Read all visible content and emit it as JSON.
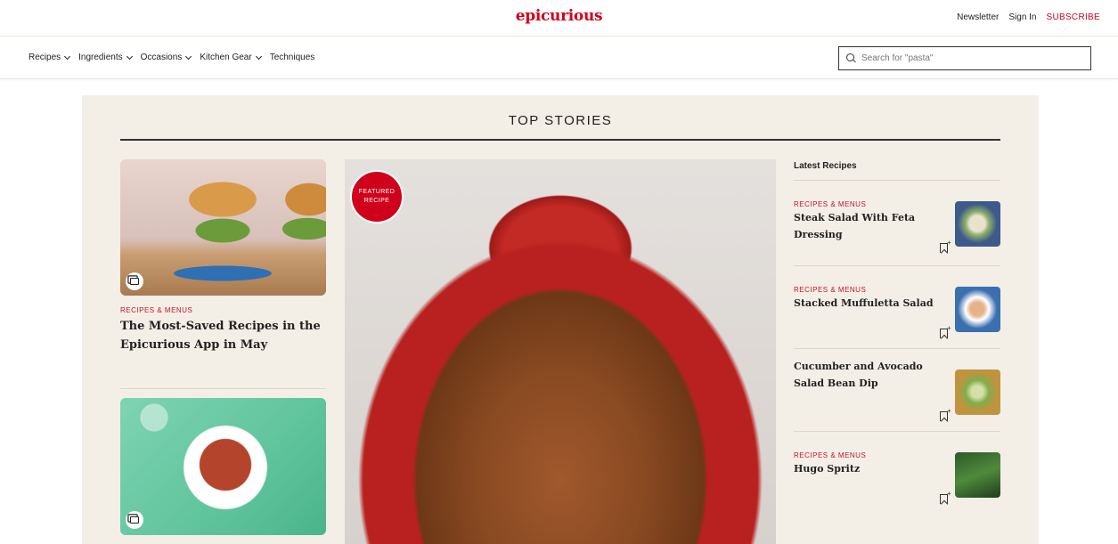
{
  "header": {
    "logo": "epicurious",
    "links": {
      "newsletter": "Newsletter",
      "sign_in": "Sign In",
      "subscribe": "SUBSCRIBE"
    }
  },
  "nav": {
    "items": [
      "Recipes",
      "Ingredients",
      "Occasions",
      "Kitchen Gear",
      "Techniques"
    ],
    "search_placeholder": "Search for \"pasta\""
  },
  "top_stories": {
    "title": "TOP STORIES",
    "left_cards": [
      {
        "kicker": "RECIPES & MENUS",
        "title": "The Most-Saved Recipes in the Epicurious App in May",
        "image": "burgers"
      },
      {
        "kicker": "",
        "title": "",
        "image": "bowl"
      }
    ],
    "featured": {
      "badge_line1": "FEATURED",
      "badge_line2": "RECIPE",
      "image": "bread-in-red-pot"
    },
    "latest": {
      "heading": "Latest Recipes",
      "items": [
        {
          "kicker": "RECIPES & MENUS",
          "title": "Steak Salad With Feta Dressing"
        },
        {
          "kicker": "RECIPES & MENUS",
          "title": "Stacked Muffuletta Salad"
        },
        {
          "kicker": "",
          "title": "Cucumber and Avocado Salad Bean Dip"
        },
        {
          "kicker": "RECIPES & MENUS",
          "title": "Hugo Spritz"
        }
      ]
    }
  },
  "colors": {
    "brand": "#d0021b",
    "panel_bg": "#f3efe6"
  },
  "icons": [
    "search-icon",
    "chevron-down-icon",
    "gallery-icon",
    "bookmark-add-icon"
  ]
}
